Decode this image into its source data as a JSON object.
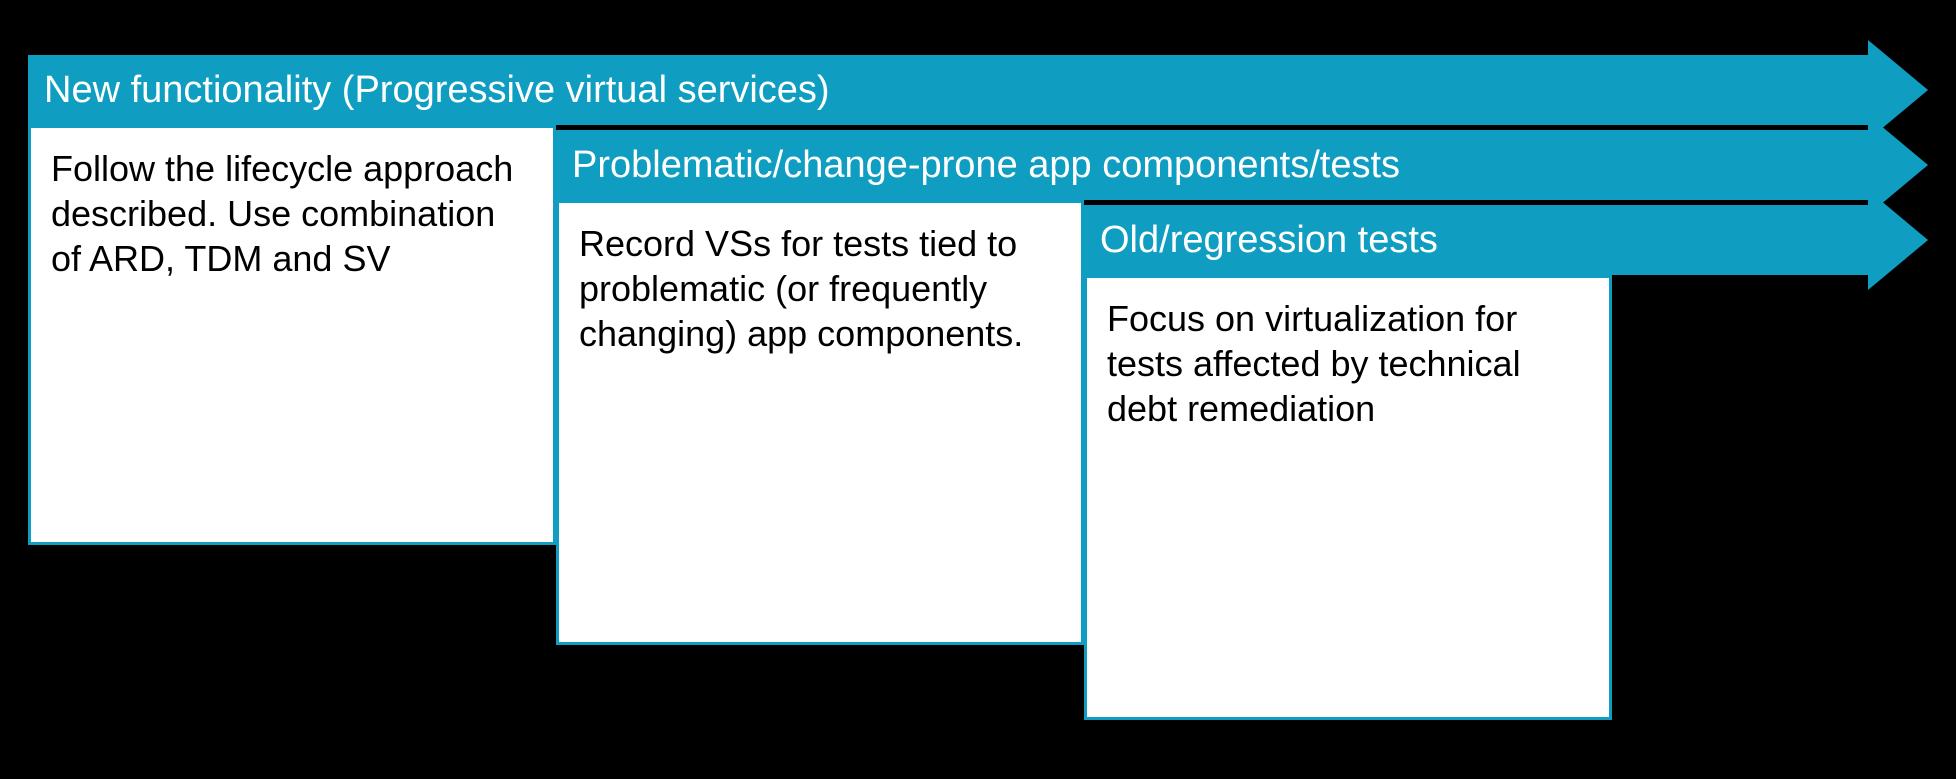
{
  "panels": [
    {
      "title": "New functionality (Progressive virtual services)",
      "body": "Follow the lifecycle approach described. Use combination of ARD, TDM and SV"
    },
    {
      "title": "Problematic/change-prone app components/tests",
      "body": "Record VSs for tests tied to problematic (or frequently changing) app components."
    },
    {
      "title": "Old/regression tests",
      "body": "Focus on virtualization for tests affected by technical debt remediation"
    }
  ]
}
